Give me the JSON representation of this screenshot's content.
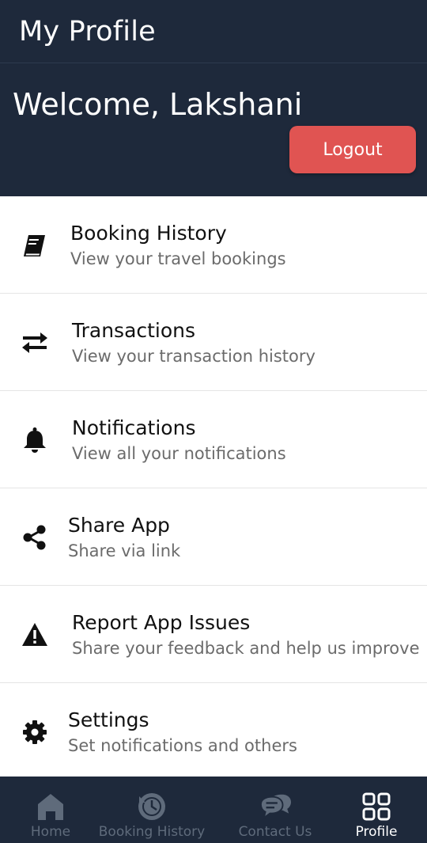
{
  "appbar": {
    "title": "My Profile"
  },
  "header": {
    "welcome": "Welcome, Lakshani",
    "logout_label": "Logout"
  },
  "menu": [
    {
      "title": "Booking History",
      "subtitle": "View your travel bookings",
      "icon": "book-icon"
    },
    {
      "title": "Transactions",
      "subtitle": "View your transaction history",
      "icon": "swap-arrows-icon"
    },
    {
      "title": "Notifications",
      "subtitle": "View all your notifications",
      "icon": "bell-icon"
    },
    {
      "title": "Share App",
      "subtitle": "Share via link",
      "icon": "share-icon"
    },
    {
      "title": "Report App Issues",
      "subtitle": "Share your feedback and help us improve",
      "icon": "warning-icon"
    },
    {
      "title": "Settings",
      "subtitle": "Set notifications and others",
      "icon": "gear-icon"
    }
  ],
  "bottom_nav": {
    "items": [
      {
        "label": "Home",
        "icon": "home-icon",
        "active": false
      },
      {
        "label": "Booking History",
        "icon": "history-clock-icon",
        "active": false
      },
      {
        "label": "Contact Us",
        "icon": "chat-bubbles-icon",
        "active": false
      },
      {
        "label": "Profile",
        "icon": "grid-icon",
        "active": true
      }
    ]
  },
  "colors": {
    "header_bg": "#1e293b",
    "logout_bg": "#e05452",
    "nav_inactive": "#5f6b7b",
    "nav_active": "#ffffff"
  }
}
